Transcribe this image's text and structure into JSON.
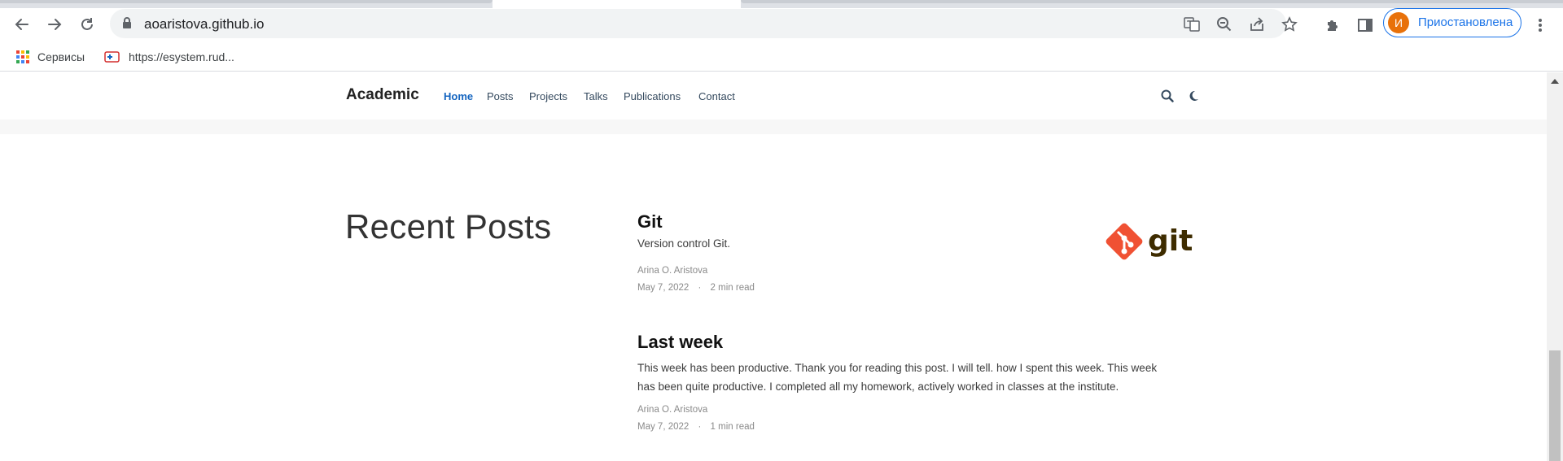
{
  "browser": {
    "url": "aoaristova.github.io",
    "profile_initial": "И",
    "profile_label": "Приостановлена",
    "bookmarks": [
      {
        "label": "Сервисы",
        "icon": "apps-grid-icon"
      },
      {
        "label": "https://esystem.rud...",
        "icon": "site-favicon-icon"
      }
    ],
    "colors": {
      "accent": "#1a73e8",
      "avatar": "#e8710a"
    }
  },
  "site": {
    "brand": "Academic",
    "nav": [
      {
        "label": "Home",
        "active": true
      },
      {
        "label": "Posts",
        "active": false
      },
      {
        "label": "Projects",
        "active": false
      },
      {
        "label": "Talks",
        "active": false
      },
      {
        "label": "Publications",
        "active": false
      },
      {
        "label": "Contact",
        "active": false
      }
    ],
    "nav_active_color": "#1565c0"
  },
  "main": {
    "section_title": "Recent Posts",
    "posts": [
      {
        "title": "Git",
        "summary": "Version control Git.",
        "author": "Arina O. Aristova",
        "date": "May 7, 2022",
        "separator": "·",
        "reading_time": "2 min read",
        "thumbnail_text": "git"
      },
      {
        "title": "Last week",
        "summary": "This week has been productive. Thank you for reading this post. I will tell. how I spent this week. This week has been quite productive. I completed all my homework, actively worked in classes at the institute.",
        "author": "Arina O. Aristova",
        "date": "May 7, 2022",
        "separator": "·",
        "reading_time": "1 min read"
      }
    ]
  }
}
